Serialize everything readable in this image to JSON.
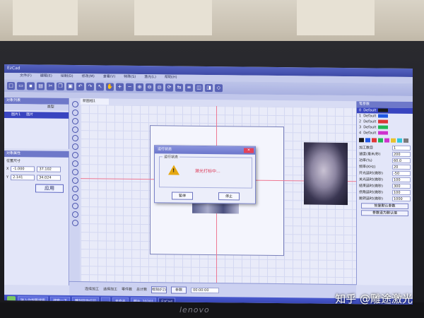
{
  "window": {
    "title": "EzCad"
  },
  "menu": {
    "items": [
      "文件(F)",
      "编辑(E)",
      "绘制(D)",
      "修改(M)",
      "查看(V)",
      "特殊(S)",
      "激光(L)",
      "帮助(H)"
    ]
  },
  "object_list": {
    "header": "对象列表",
    "columns": [
      "",
      "类型"
    ],
    "row": {
      "name": "图片1",
      "type": "图片"
    }
  },
  "size_panel": {
    "header": "对象属性",
    "label": "位置尺寸",
    "x_value": "-1.000",
    "y_value": "2.141",
    "w_value": "37.102",
    "h_value": "34.024",
    "apply_label": "应用"
  },
  "canvas": {
    "tab_label": "新图档1"
  },
  "dialog": {
    "title": "运行状态",
    "group_label": "运行状态",
    "message": "激光打标中...",
    "pause_label": "暂停",
    "stop_label": "停止"
  },
  "pen_panel": {
    "header": "笔参数",
    "pens": [
      {
        "num": "0",
        "name": "Default",
        "color": "#1a1a1a"
      },
      {
        "num": "1",
        "name": "Default",
        "color": "#2457d6"
      },
      {
        "num": "2",
        "name": "Default",
        "color": "#d23939"
      },
      {
        "num": "3",
        "name": "Default",
        "color": "#2cb35a"
      },
      {
        "num": "4",
        "name": "Default",
        "color": "#c436c4"
      }
    ],
    "params": [
      {
        "label": "加工数目",
        "value": "1"
      },
      {
        "label": "速度(毫米/秒)",
        "value": "200"
      },
      {
        "label": "功率(%)",
        "value": "60.0"
      },
      {
        "label": "频率(KHz)",
        "value": "20"
      },
      {
        "label": "开光延时(微秒)",
        "value": "-50"
      },
      {
        "label": "关光延时(微秒)",
        "value": "100"
      },
      {
        "label": "结束延时(微秒)",
        "value": "300"
      },
      {
        "label": "拐角延时(微秒)",
        "value": "100"
      },
      {
        "label": "跳转延时(微秒)",
        "value": "1000"
      }
    ],
    "default_btn": "恢复默认参数",
    "set_default_btn": "参数设为默认值"
  },
  "bottom_bar": {
    "continuous_label": "连续加工",
    "select_label": "选择加工",
    "parts_label": "零件数",
    "total_label": "总计数",
    "mark_btn": "标刻(F2)",
    "param_btn": "参数",
    "time_value": "00:00:00"
  },
  "taskbar": {
    "tasks": [
      {
        "label": "输入你想要搜索",
        "active": false
      },
      {
        "label": "搜索一下",
        "active": false
      },
      {
        "label": "雕刻软件打印",
        "active": false
      },
      {
        "label": "...",
        "active": false
      },
      {
        "label": "未命名",
        "active": false
      },
      {
        "label": "照片_20201",
        "active": false
      },
      {
        "label": "EzCad",
        "active": true
      }
    ]
  },
  "photo": {
    "brand": "lenovo",
    "watermark": "知乎 @雕途激光"
  }
}
